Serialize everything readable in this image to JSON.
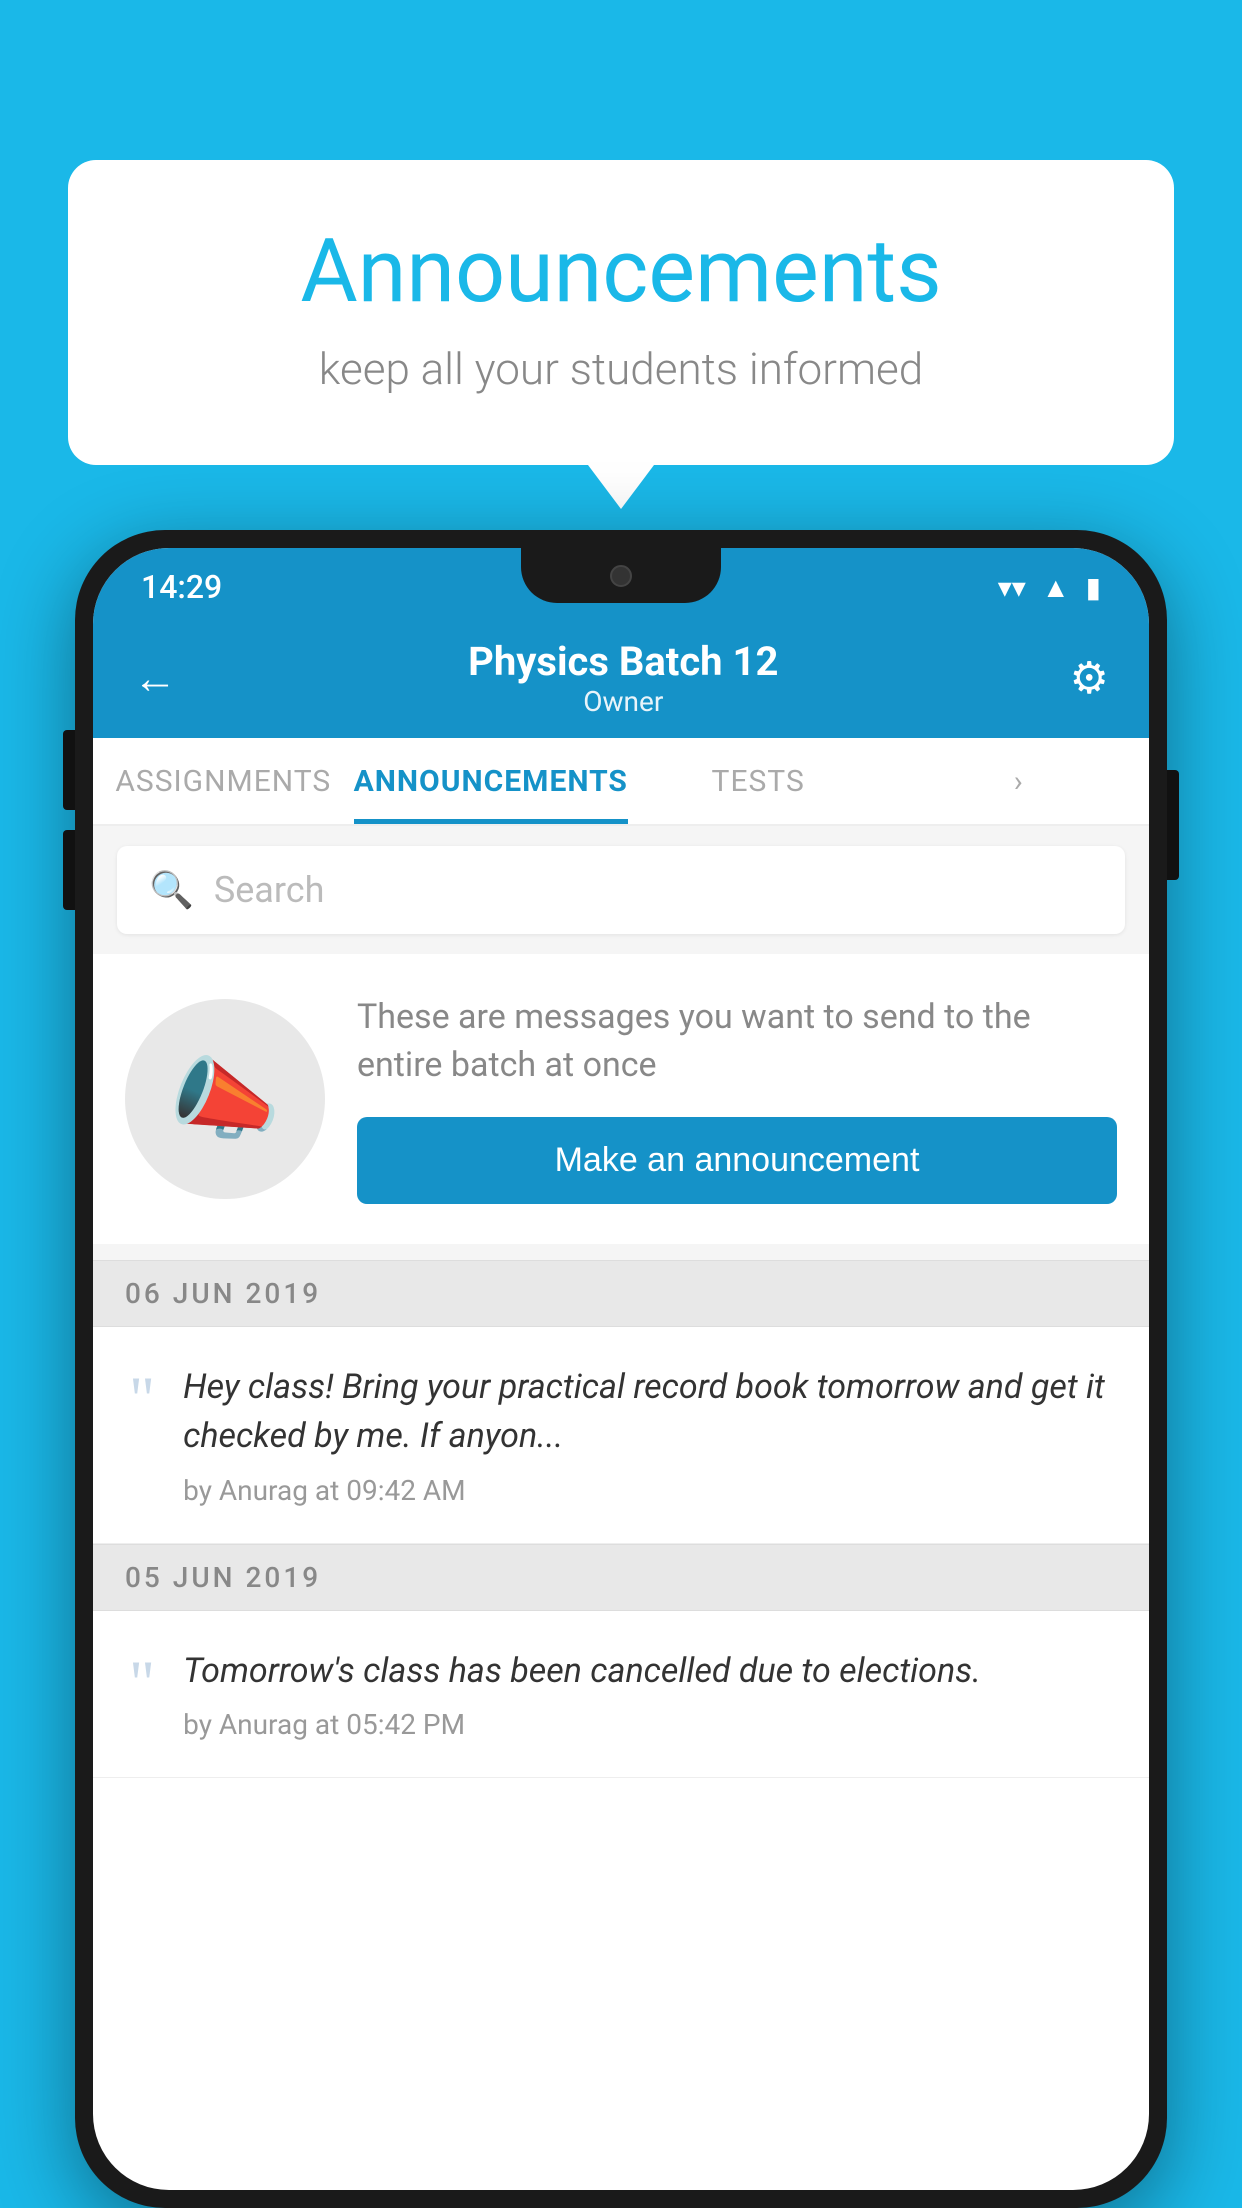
{
  "speechBubble": {
    "title": "Announcements",
    "subtitle": "keep all your students informed"
  },
  "statusBar": {
    "time": "14:29",
    "wifiIcon": "▼",
    "signalIcon": "▲",
    "batteryIcon": "▮"
  },
  "header": {
    "title": "Physics Batch 12",
    "subtitle": "Owner",
    "backLabel": "←",
    "gearLabel": "⚙"
  },
  "tabs": [
    {
      "label": "ASSIGNMENTS",
      "active": false
    },
    {
      "label": "ANNOUNCEMENTS",
      "active": true
    },
    {
      "label": "TESTS",
      "active": false
    },
    {
      "label": "...",
      "active": false
    }
  ],
  "search": {
    "placeholder": "Search"
  },
  "promoCard": {
    "description": "These are messages you want to send to the entire batch at once",
    "buttonLabel": "Make an announcement"
  },
  "announcements": [
    {
      "dateLabel": "06  JUN  2019",
      "text": "Hey class! Bring your practical record book tomorrow and get it checked by me. If anyon...",
      "meta": "by Anurag at 09:42 AM"
    },
    {
      "dateLabel": "05  JUN  2019",
      "text": "Tomorrow's class has been cancelled due to elections.",
      "meta": "by Anurag at 05:42 PM"
    }
  ]
}
